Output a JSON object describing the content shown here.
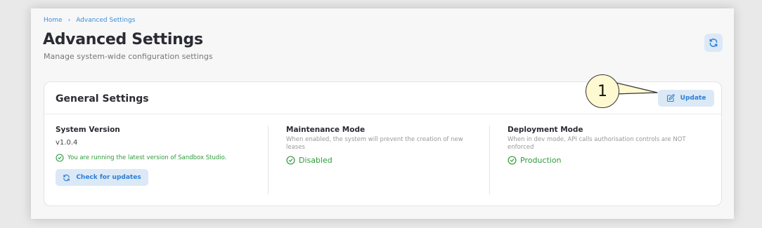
{
  "breadcrumb": {
    "home": "Home",
    "separator": "›",
    "current": "Advanced Settings"
  },
  "header": {
    "title": "Advanced Settings",
    "subtitle": "Manage system-wide configuration settings",
    "refresh_icon": "refresh-icon"
  },
  "card": {
    "title": "General Settings",
    "update_label": "Update",
    "update_icon": "edit-icon",
    "system_version": {
      "title": "System Version",
      "value": "v1.0.4",
      "status": "You are running the latest version of Sandbox Studio.",
      "check_label": "Check for updates"
    },
    "maintenance": {
      "title": "Maintenance Mode",
      "description": "When enabled, the system will prevent the creation of new leases",
      "status": "Disabled"
    },
    "deployment": {
      "title": "Deployment Mode",
      "description": "When in dev mode, API calls authorisation controls are NOT enforced",
      "status": "Production"
    }
  },
  "callout": {
    "number": "1"
  },
  "colors": {
    "accent": "#2e7ed2",
    "accent_bg": "#dbe9f7",
    "success": "#2e9b3b",
    "callout_bg": "#fff9d2"
  }
}
